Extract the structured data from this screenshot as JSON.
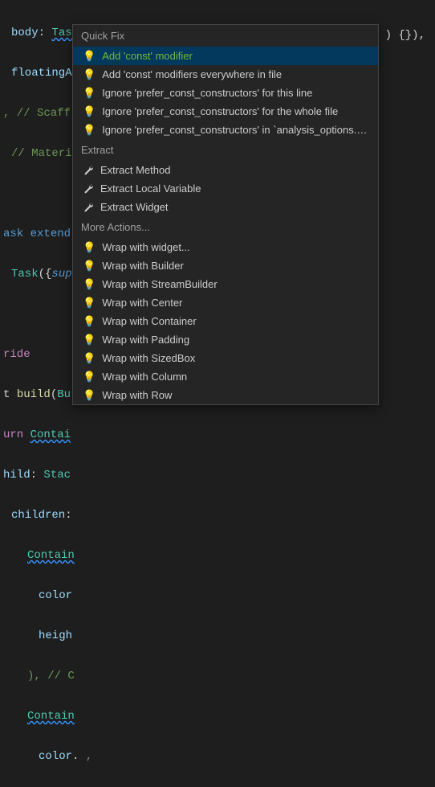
{
  "code": {
    "l1_prop": "body",
    "l1_class": "Task",
    "l2_prop": "floatingA",
    "l2_tail": ") {}),",
    "l3_comment": ", // Scaff",
    "l4_comment": "// Materia",
    "l5_kw1": "ask",
    "l5_kw2": "extend",
    "l6_class": "Task",
    "l6_sup": "sup",
    "l7_override": "ride",
    "l8_func": "build",
    "l8_param": "Bu",
    "l8_ret": "t ",
    "l9_kw": "urn ",
    "l9_class": "Contai",
    "l10_prop": "hild",
    "l10_class": "Stac",
    "l11_prop": "children",
    "l12_class": "Contain",
    "l13_prop": "color",
    "l14_prop": "heigh",
    "l15_comment": "), // C",
    "l16_class": "Contain",
    "l17_prop": "color",
    "l17_tail": ". ",
    "l17_rest": ","
  },
  "popup": {
    "headers": {
      "quickfix": "Quick Fix",
      "extract": "Extract",
      "more": "More Actions..."
    },
    "quickfix_items": [
      "Add 'const' modifier",
      "Add 'const' modifiers everywhere in file",
      "Ignore 'prefer_const_constructors' for this line",
      "Ignore 'prefer_const_constructors' for the whole file",
      "Ignore 'prefer_const_constructors' in `analysis_options.yaml`"
    ],
    "extract_items": [
      "Extract Method",
      "Extract Local Variable",
      "Extract Widget"
    ],
    "more_items": [
      "Wrap with widget...",
      "Wrap with Builder",
      "Wrap with StreamBuilder",
      "Wrap with Center",
      "Wrap with Container",
      "Wrap with Padding",
      "Wrap with SizedBox",
      "Wrap with Column",
      "Wrap with Row"
    ]
  }
}
